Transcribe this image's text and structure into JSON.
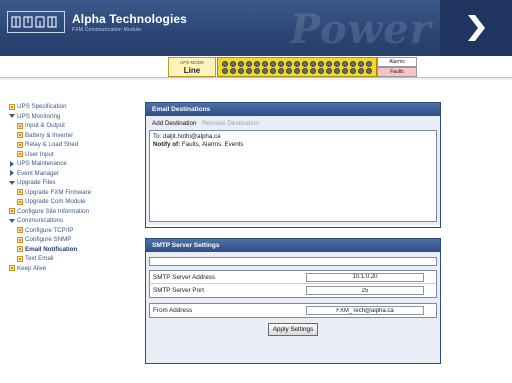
{
  "header": {
    "brand": "Alpha Technologies",
    "subtitle": "FXM Communication Module",
    "watermark": "Power",
    "logo_icon": "alpha-logo-icon",
    "chevron_icon": "chevron-right-icon"
  },
  "status": {
    "mode_label": "UPS MODE",
    "mode_value": "Line",
    "alarms_label": "Alarms",
    "faults_label": "Faults",
    "led_rows": 2,
    "led_count_per_row": 19,
    "colors": {
      "mode_bg": "#fff4b8",
      "led_bar": "#f1d72a",
      "faults_bg": "#f7c3c9"
    }
  },
  "sidebar": {
    "items": [
      {
        "label": "UPS Specification",
        "icon": "page-icon",
        "level": 0
      },
      {
        "label": "UPS Monitoring",
        "icon": "expand-down-icon",
        "level": 0
      },
      {
        "label": "Input & Output",
        "icon": "page-icon",
        "level": 1
      },
      {
        "label": "Battery & Inverter",
        "icon": "page-icon",
        "level": 1
      },
      {
        "label": "Relay & Load Shed",
        "icon": "page-icon",
        "level": 1
      },
      {
        "label": "User Input",
        "icon": "page-icon",
        "level": 1
      },
      {
        "label": "UPS Maintenance",
        "icon": "expand-right-icon",
        "level": 0
      },
      {
        "label": "Event Manager",
        "icon": "expand-right-icon",
        "level": 0
      },
      {
        "label": "Upgrade Files",
        "icon": "expand-down-icon",
        "level": 0
      },
      {
        "label": "Upgrade FXM Firmware",
        "icon": "page-icon",
        "level": 1
      },
      {
        "label": "Upgrade Com Module",
        "icon": "page-icon",
        "level": 1
      },
      {
        "label": "Configure Site Information",
        "icon": "page-icon",
        "level": 0
      },
      {
        "label": "Communications",
        "icon": "expand-down-icon",
        "level": 0
      },
      {
        "label": "Configure TCP/IP",
        "icon": "page-icon",
        "level": 1
      },
      {
        "label": "Configure SNMP",
        "icon": "page-icon",
        "level": 1
      },
      {
        "label": "Email Notification",
        "icon": "page-icon",
        "level": 1,
        "active": true
      },
      {
        "label": "Text Email",
        "icon": "page-icon",
        "level": 1
      },
      {
        "label": "Keep Alive",
        "icon": "page-icon",
        "level": 0
      }
    ]
  },
  "email": {
    "title": "Email Destinations",
    "add_label": "Add Destination",
    "remove_label": "Remove Destination",
    "to_prefix": "To:",
    "to_address": "daljit.hothi@alpha.ca",
    "notify_prefix": "Notify of:",
    "notify_value": "Faults, Alarms, Events"
  },
  "smtp": {
    "title": "SMTP Server Settings",
    "server_address_label": "SMTP Server Address",
    "server_address_value": "10.1.0.20",
    "server_port_label": "SMTP Server Port",
    "server_port_value": "25",
    "from_label": "From Address",
    "from_value": "FXM_Tech@alpha.ca",
    "apply_label": "Apply Settings"
  }
}
